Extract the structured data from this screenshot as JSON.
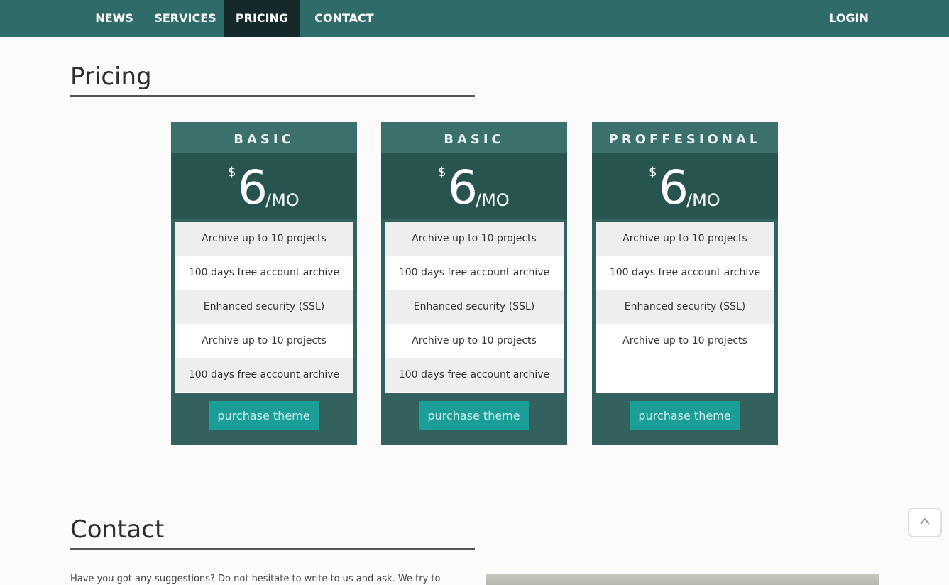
{
  "nav": {
    "items": [
      {
        "label": "NEWS"
      },
      {
        "label": "SERVICES"
      },
      {
        "label": "PRICING",
        "active": true
      },
      {
        "label": "CONTACT"
      }
    ],
    "login": "LOGIN"
  },
  "pricing": {
    "title": "Pricing",
    "plans": [
      {
        "name": "BASIC",
        "currency": "$",
        "amount": "6",
        "period": "/MO",
        "features": [
          "Archive up to 10 projects",
          "100 days free account archive",
          "Enhanced security (SSL)",
          "Archive up to 10 projects",
          "100 days free account archive"
        ],
        "button": "purchase theme"
      },
      {
        "name": "BASIC",
        "currency": "$",
        "amount": "6",
        "period": "/MO",
        "features": [
          "Archive up to 10 projects",
          "100 days free account archive",
          "Enhanced security (SSL)",
          "Archive up to 10 projects",
          "100 days free account archive"
        ],
        "button": "purchase theme"
      },
      {
        "name": "PROFFESIONAL",
        "currency": "$",
        "amount": "6",
        "period": "/MO",
        "features": [
          "Archive up to 10 projects",
          "100 days free account archive",
          "Enhanced security (SSL)",
          "Archive up to 10 projects"
        ],
        "button": "purchase theme"
      }
    ]
  },
  "contact": {
    "title": "Contact",
    "text": "Have you got any suggestions? Do not hesitate to write to us and ask. We try to"
  },
  "icons": {
    "back_to_top": "chevron-up-icon"
  },
  "colors": {
    "navbar": "#2f6b68",
    "nav_active": "#15292a",
    "card": "#33615e",
    "price_band": "#285450",
    "button": "#1b9e98"
  }
}
